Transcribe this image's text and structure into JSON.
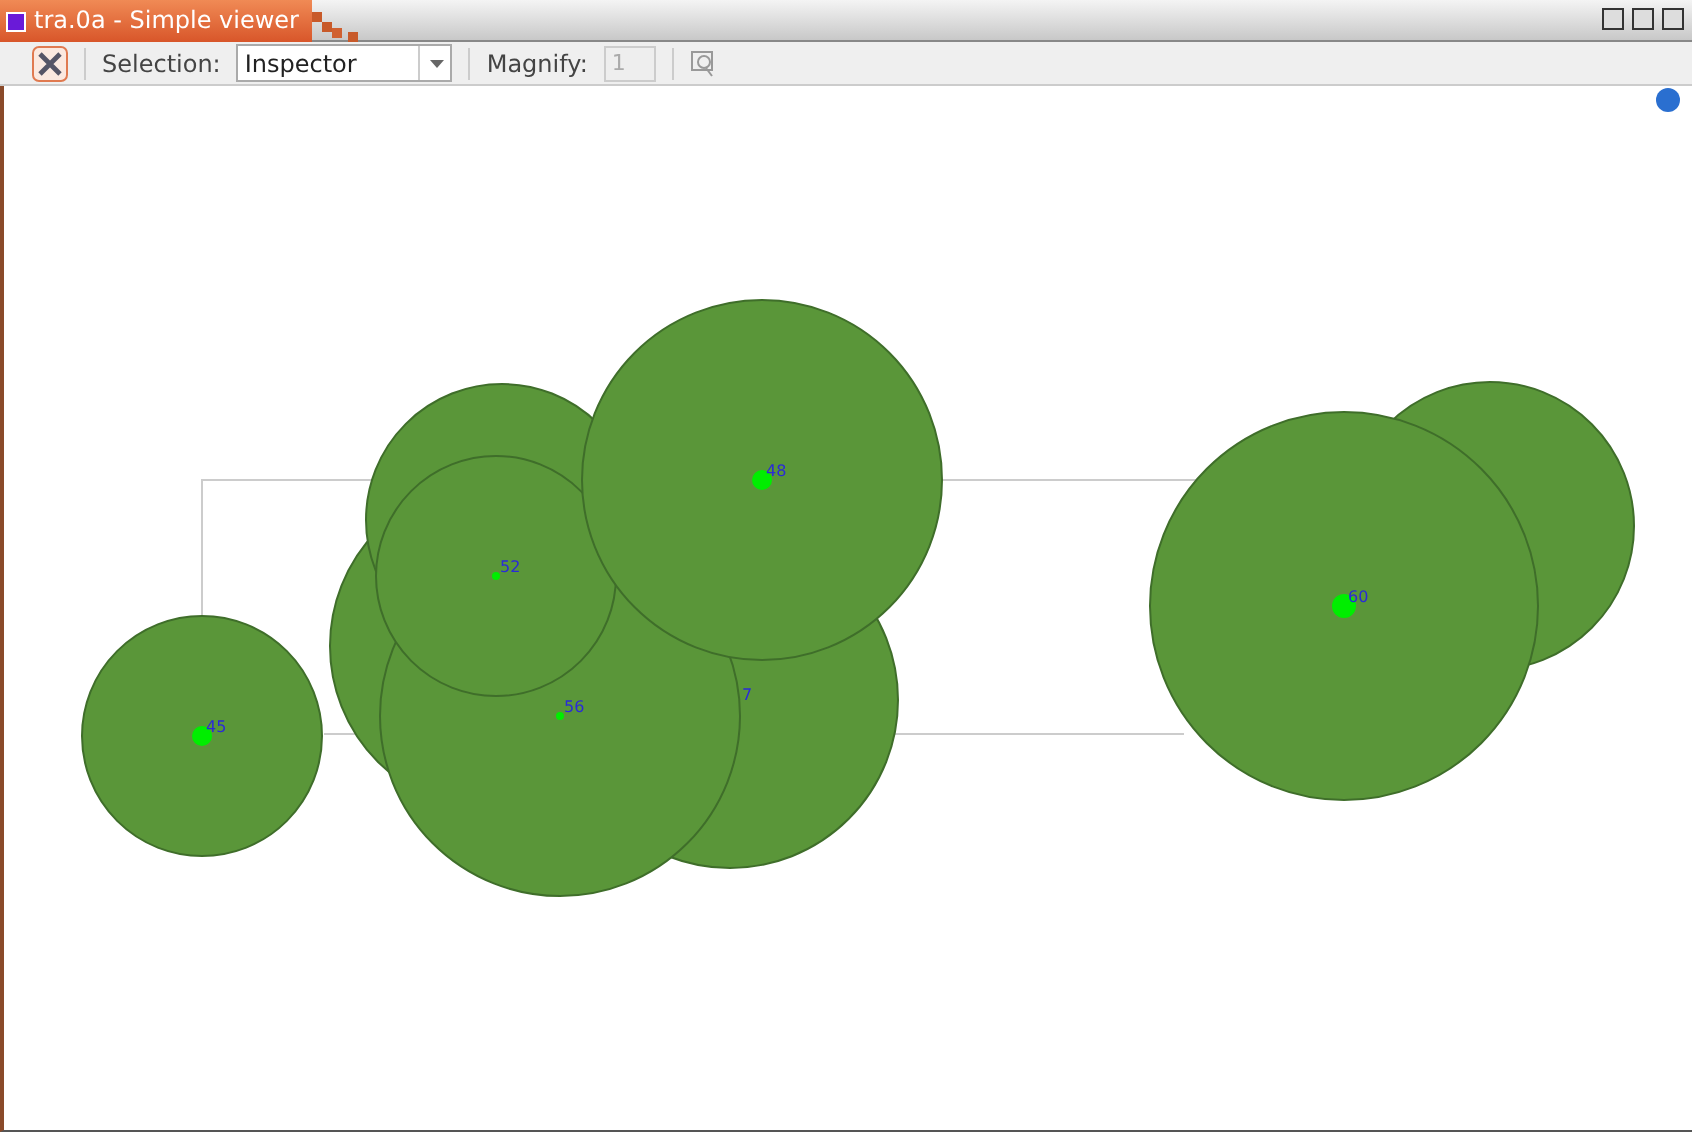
{
  "window": {
    "title": "tra.0a - Simple viewer"
  },
  "toolbar": {
    "selection_label": "Selection:",
    "selection_value": "Inspector",
    "magnify_label": "Magnify:",
    "magnify": {
      "value": "1",
      "disabled": true
    }
  },
  "nodes": [
    {
      "label": "7"
    },
    {
      "label": "56"
    },
    {
      "label": "52"
    },
    {
      "label": "48"
    },
    {
      "label": "60"
    },
    {
      "label": "45"
    }
  ]
}
